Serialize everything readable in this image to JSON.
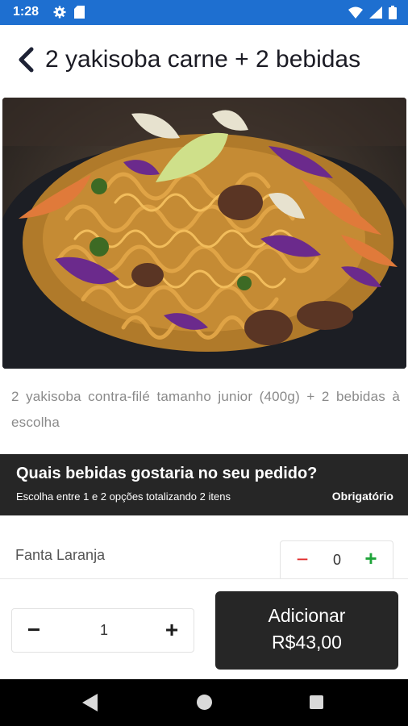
{
  "status_bar": {
    "time": "1:28"
  },
  "header": {
    "title": "2 yakisoba carne + 2 bebidas"
  },
  "product": {
    "image_alt": "Prato de yakisoba com carne, macarrão e legumes",
    "description": "2 yakisoba contra-filé tamanho junior (400g) + 2 bebidas à escolha"
  },
  "section": {
    "question": "Quais bebidas gostaria no seu pedido?",
    "subtitle": "Escolha entre 1 e 2 opções totalizando 2 itens",
    "required": "Obrigatório"
  },
  "options": [
    {
      "name": "Fanta Laranja",
      "quantity": "0",
      "minus": "−",
      "plus": "+"
    }
  ],
  "footer": {
    "quantity": "1",
    "minus": "−",
    "plus": "+",
    "add_label": "Adicionar",
    "price": "R$43,00"
  },
  "colors": {
    "status_bar": "#1e6fd0",
    "dark": "#262626",
    "minus_red": "#e02b2b",
    "plus_green": "#1fa43a"
  },
  "icons": [
    "settings-icon",
    "sd-card-icon",
    "wifi-icon",
    "signal-icon",
    "battery-icon",
    "back-arrow-icon",
    "nav-back-icon",
    "nav-home-icon",
    "nav-recent-icon"
  ]
}
